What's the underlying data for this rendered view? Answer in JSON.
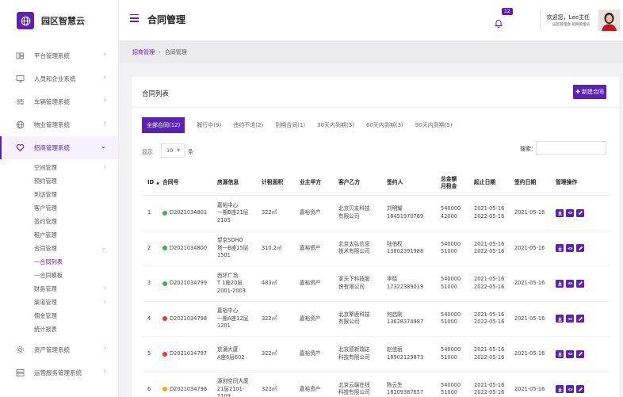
{
  "brand": {
    "name": "园区智慧云"
  },
  "sidebar": {
    "menu_top": [
      {
        "label": "平台管理系统",
        "icon": "module-icon"
      },
      {
        "label": "人员和企业系统",
        "icon": "monitor-icon"
      },
      {
        "label": "车辆管理系统",
        "icon": "sliders-icon"
      },
      {
        "label": "物业管理系统",
        "icon": "globe-icon"
      }
    ],
    "active": {
      "label": "招商管理系统",
      "icon": "heart-icon"
    },
    "sub_items": [
      "空间管理",
      "预约管理",
      "到访管理",
      "客户管理",
      "签约管理",
      "租户管理",
      "合同管理"
    ],
    "contract_children": [
      "一合同列表",
      "一合同模板"
    ],
    "sub_items_after": [
      "财务管理",
      "渠道管理",
      "佣金管理",
      "统计报表"
    ],
    "menu_bottom": [
      {
        "label": "资产管理系统",
        "icon": "gear-icon"
      },
      {
        "label": "运营服务管理系统",
        "icon": "server-icon"
      }
    ]
  },
  "topbar": {
    "title": "合同管理",
    "badge": "12",
    "welcome": "欢迎您，Lee主任",
    "role": "园区管理会-招商管理员"
  },
  "breadcrumb": {
    "home": "招商管理",
    "current": "合同管理"
  },
  "card": {
    "title": "合同列表",
    "new_button": "新建合同"
  },
  "tabs": [
    "全部合同(12)",
    "履行中(9)",
    "违约不退(2)",
    "到期合同(1)",
    "30天内到期(3)",
    "60天内到期(3)",
    "90天内到期(5)"
  ],
  "controls": {
    "show_label": "显示",
    "page_size": "10",
    "rows_label": "条",
    "search_label": "搜索："
  },
  "table": {
    "headers": {
      "id": "ID",
      "contract_no": "合同号",
      "house": "房源信息",
      "area": "计租面积",
      "party_a": "业主甲方",
      "party_b": "客户乙方",
      "signer": "签约人",
      "rent_1": "总金额",
      "rent_2": "月租金",
      "start": "起止日期",
      "sign_date": "签约日期",
      "ops": "管理操作"
    },
    "status_colors": {
      "green": "#3bb54a",
      "red": "#e53935",
      "orange": "#f5a623"
    },
    "rows": [
      {
        "id": "1",
        "status": "green",
        "no": "D2021034801",
        "house": [
          "嘉裕中心",
          "一期B座21层",
          "2105"
        ],
        "area": "322㎡",
        "a": "嘉裕资产",
        "b": [
          "北京贝友科技",
          "有限公司"
        ],
        "signer": [
          "刘明耀",
          "18451970789"
        ],
        "money": [
          "540000",
          "42000"
        ],
        "dates": [
          "2021-05-16",
          "2022-05-16"
        ],
        "sign_date": "2021-05-16"
      },
      {
        "id": "2",
        "status": "green",
        "no": "D2021034800",
        "house": [
          "望京SOHO",
          "塔一B座15层",
          "1501"
        ],
        "area": "310.2㎡",
        "a": "嘉裕资产",
        "b": [
          "北京太弘信息",
          "技术有限公司"
        ],
        "signer": [
          "陆伯权",
          "13802391988"
        ],
        "money": [
          "540000",
          "51000"
        ],
        "dates": [
          "2021-05-16",
          "2022-05-16"
        ],
        "sign_date": "2021-05-16"
      },
      {
        "id": "3",
        "status": "green",
        "no": "D2021034799",
        "house": [
          "西环广场",
          "T 1座20层",
          "2001-2003"
        ],
        "area": "483㎡",
        "a": "嘉裕资产",
        "b": [
          "家天下科技股",
          "份有限公司"
        ],
        "signer": [
          "李晓",
          "17322389019"
        ],
        "money": [
          "540000",
          "51000"
        ],
        "dates": [
          "2021-05-16",
          "2022-05-16"
        ],
        "sign_date": "2021-05-16"
      },
      {
        "id": "4",
        "status": "red",
        "no": "D2021034798",
        "house": [
          "嘉裕中心",
          "一期A座12层",
          "1201"
        ],
        "area": "322㎡",
        "a": "嘉裕资产",
        "b": [
          "北京擎鹿科技",
          "有限公司"
        ],
        "signer": [
          "何启刚",
          "13628374987"
        ],
        "money": [
          "540000",
          "51000"
        ],
        "dates": [
          "2021-05-16",
          "2022-05-16"
        ],
        "sign_date": "2021-05-16"
      },
      {
        "id": "5",
        "status": "red",
        "no": "D2021034797",
        "house": [
          "京通大厦",
          "A座6层602"
        ],
        "area": "322㎡",
        "a": "嘉裕资产",
        "b": [
          "北京德新瑞达",
          "科技有限公司"
        ],
        "signer": [
          "赵佳丽",
          "18902129873"
        ],
        "money": [
          "540000",
          "51000"
        ],
        "dates": [
          "2021-05-16",
          "2022-05-16"
        ],
        "sign_date": "2021-05-16"
      },
      {
        "id": "6",
        "status": "orange",
        "no": "D2021034796",
        "house": [
          "源创空间大厦",
          "21层2101-",
          "2109"
        ],
        "area": "322㎡",
        "a": "嘉裕资产",
        "b": [
          "北京云端在线",
          "科技有限公司"
        ],
        "signer": [
          "陈云生",
          "18109387657"
        ],
        "money": [
          "540000",
          "51000"
        ],
        "dates": [
          "2021-05-16",
          "2022-05-16"
        ],
        "sign_date": "2021-05-16"
      }
    ]
  },
  "colors": {
    "accent": "#5b21b6"
  }
}
